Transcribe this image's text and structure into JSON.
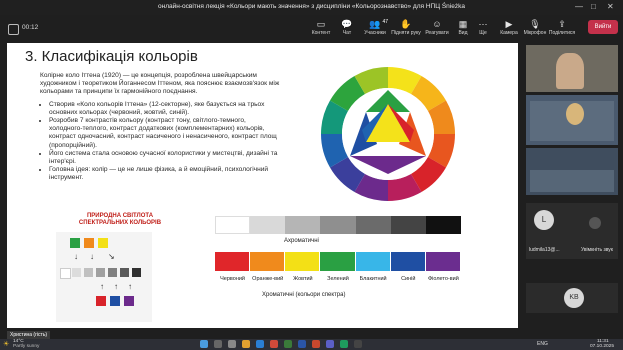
{
  "window": {
    "title": "онлайн-освітня лекція «Кольори мають значення» з дисципліни «Кольорознавство» для НПЦ Śnieżka",
    "controls": [
      "—",
      "□",
      "✕"
    ]
  },
  "toolbar": {
    "timer": "00:12",
    "items": [
      {
        "label": "Контент",
        "icon": "▭"
      },
      {
        "label": "Чат",
        "icon": "💬"
      },
      {
        "label": "Учасники",
        "icon": "👥",
        "count": "47"
      },
      {
        "label": "Підняти руку",
        "icon": "✋"
      },
      {
        "label": "Реагувати",
        "icon": "☺"
      },
      {
        "label": "Вид",
        "icon": "▦"
      },
      {
        "label": "Ще",
        "icon": "⋯"
      },
      {
        "label": "Камера",
        "icon": "▶"
      },
      {
        "label": "Мікрофон",
        "icon": "🎙"
      },
      {
        "label": "Поділитися",
        "icon": "⇪"
      }
    ],
    "leave_label": "Вийти"
  },
  "slide": {
    "title": "3. Класифікація кольорів",
    "intro": "Колірне коло Іттена (1920) — це концепція, розроблена швейцарським художником і теоретиком Йоганнесом Іттеном, яка пояснює взаємозв'язок між кольорами та принципи їх гармонійного поєднання.",
    "bullets": [
      "Створив «Коло кольорів Іттена» (12-секторне), яке базується на трьох основних кольорах (червоний, жовтий, синій).",
      "Розробив 7 контрастів кольору (контраст тону, світлого-темного, холодного-теплого, контраст додаткових (комплементарних) кольорів, контраст одночасний, контраст насиченого і ненасиченого, контраст площ (пропорційний).",
      "Його система стала основою сучасної колористики у мистецтві, дизайні та інтер'єрі.",
      " Головна ідея: колір — це не лише фізика, а й емоційний, психологічний інструмент."
    ],
    "figure_title": "ПРИРОДНА СВІТЛОТА СПЕКТРАЛЬНИХ КОЛЬОРІВ",
    "achromatic_label": "Ахроматичні",
    "chromatic_label": "Хроматичні (кольори спектра)",
    "achromatic_colors": [
      "#ffffff",
      "#d9d9d9",
      "#b5b5b5",
      "#8f8f8f",
      "#6b6b6b",
      "#444444",
      "#111111"
    ],
    "spectrum": [
      {
        "name": "Червоний",
        "color": "#e0262a"
      },
      {
        "name": "Оранже-вий",
        "color": "#f08a1c"
      },
      {
        "name": "Жовтий",
        "color": "#f3e016"
      },
      {
        "name": "Зелений",
        "color": "#2aa043"
      },
      {
        "name": "Блакитний",
        "color": "#38b6e8"
      },
      {
        "name": "Синій",
        "color": "#1f4fa3"
      },
      {
        "name": "Фіолето-вий",
        "color": "#6b2d8f"
      }
    ]
  },
  "participants": [
    {
      "name": "",
      "type": "video"
    },
    {
      "name": "",
      "type": "video"
    },
    {
      "name": "",
      "type": "video"
    },
    {
      "name": "ludmila13@...",
      "initials": "L",
      "type": "avatar",
      "avatar_color": "#d8d8d8"
    },
    {
      "name": "Увімкніть звук",
      "type": "button"
    },
    {
      "name": "",
      "initials": "KB",
      "type": "avatar",
      "avatar_color": "#d8d8d8"
    }
  ],
  "presenter_label": "Христина (гість)",
  "taskbar": {
    "weather_temp": "14°C",
    "weather_text": "Partly sunny",
    "lang": "ENG",
    "time": "11:31",
    "date": "07.10.2025"
  }
}
